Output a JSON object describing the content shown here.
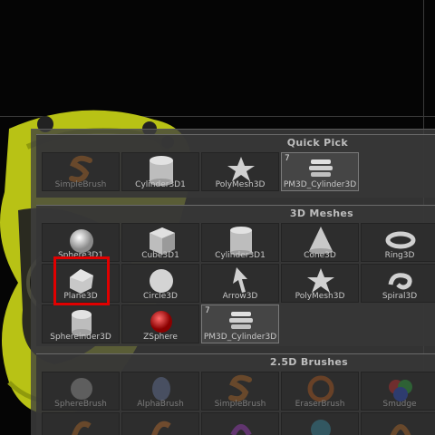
{
  "viewport": {
    "background": "#050505",
    "model_color": "#b8c215"
  },
  "quick_pick": {
    "title": "Quick Pick",
    "items": [
      {
        "label": "SimpleBrush",
        "icon": "simplebrush-icon",
        "dim": true
      },
      {
        "label": "Cylinder3D1",
        "icon": "cylinder-icon"
      },
      {
        "label": "PolyMesh3D",
        "icon": "polymesh-star-icon"
      },
      {
        "label": "PM3D_Cylinder3D",
        "icon": "pm3d-stack-icon",
        "badge": "7",
        "selected": true
      }
    ]
  },
  "meshes_3d": {
    "title": "3D Meshes",
    "items": [
      {
        "label": "Sphere3D1",
        "icon": "sphere-icon"
      },
      {
        "label": "Cube3D1",
        "icon": "cube-icon"
      },
      {
        "label": "Cylinder3D1",
        "icon": "cylinder-icon"
      },
      {
        "label": "Cone3D",
        "icon": "cone-icon"
      },
      {
        "label": "Ring3D",
        "icon": "ring-icon"
      },
      {
        "label": "Plane3D",
        "icon": "plane-icon",
        "highlighted": true
      },
      {
        "label": "Circle3D",
        "icon": "circle-icon"
      },
      {
        "label": "Arrow3D",
        "icon": "arrow-icon"
      },
      {
        "label": "PolyMesh3D",
        "icon": "polymesh-star-icon"
      },
      {
        "label": "Spiral3D",
        "icon": "spiral-icon"
      },
      {
        "label": "Sphereinder3D",
        "icon": "sphereinder-icon"
      },
      {
        "label": "ZSphere",
        "icon": "zsphere-icon"
      },
      {
        "label": "PM3D_Cylinder3D",
        "icon": "pm3d-stack-icon",
        "badge": "7",
        "selected": true
      }
    ]
  },
  "brushes_25d": {
    "title": "2.5D Brushes",
    "items": [
      {
        "label": "SphereBrush",
        "icon": "spherebrush-icon"
      },
      {
        "label": "AlphaBrush",
        "icon": "alphabrush-icon"
      },
      {
        "label": "SimpleBrush",
        "icon": "simplebrush-icon"
      },
      {
        "label": "EraserBrush",
        "icon": "eraserbrush-icon"
      },
      {
        "label": "Smudge",
        "icon": "smudge-icon"
      }
    ]
  }
}
